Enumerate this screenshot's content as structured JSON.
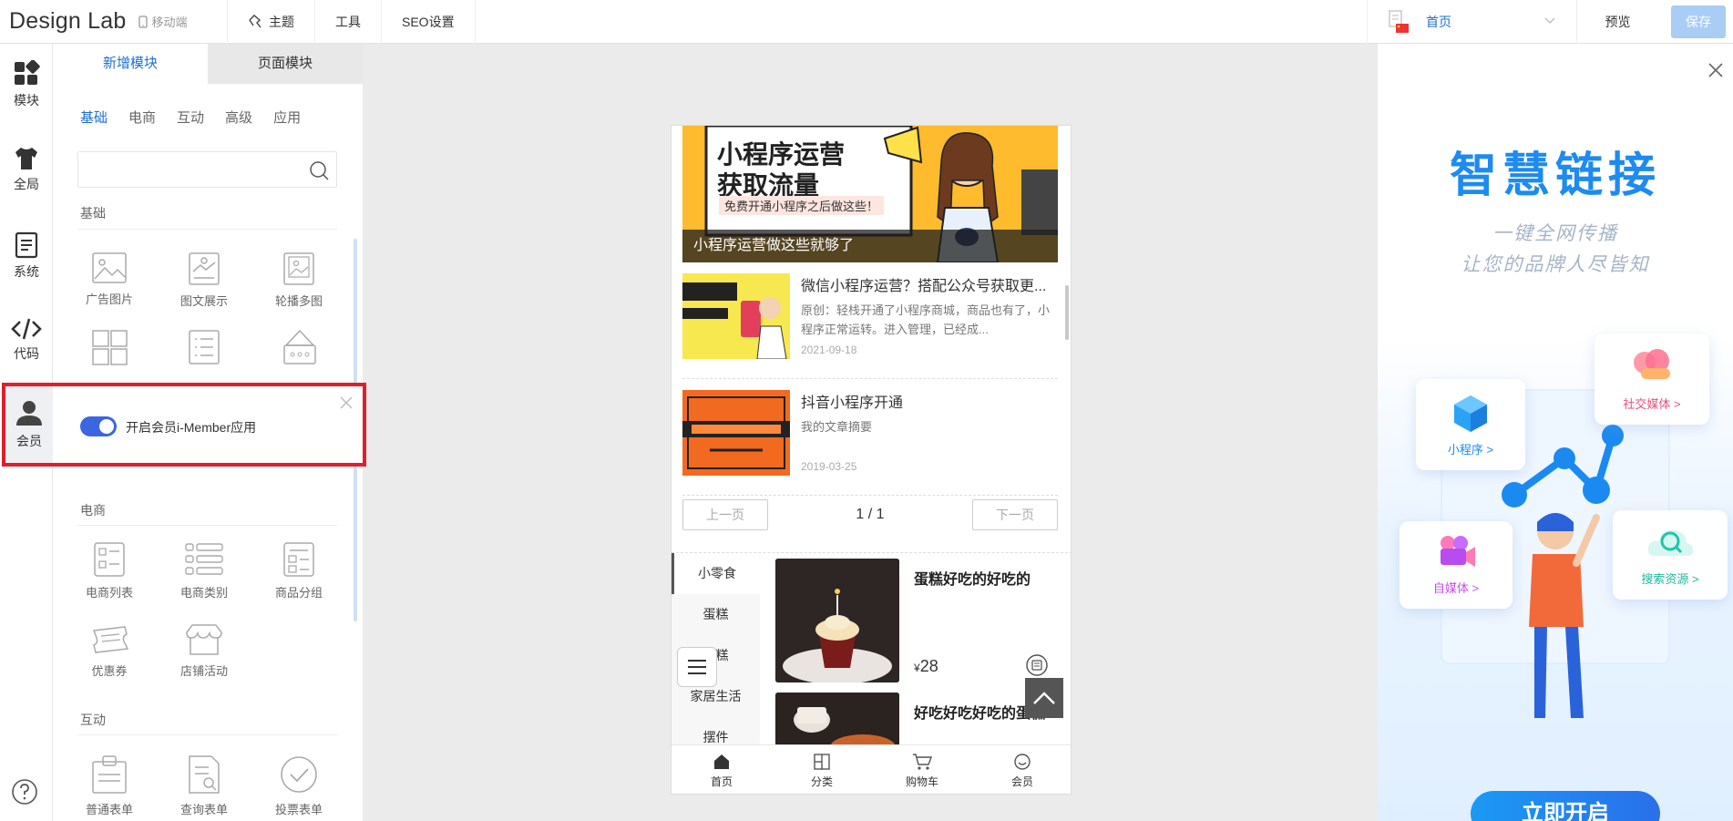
{
  "topbar": {
    "brand": "Design Lab",
    "mobile_label": "移动端",
    "nav": [
      {
        "label": "主题"
      },
      {
        "label": "工具"
      },
      {
        "label": "SEO设置"
      }
    ],
    "page_select": "首页",
    "preview": "预览",
    "save": "保存"
  },
  "rail": {
    "items": [
      {
        "label": "模块",
        "icon": "grid-icon"
      },
      {
        "label": "全局",
        "icon": "shirt-icon"
      },
      {
        "label": "系统",
        "icon": "document-icon"
      },
      {
        "label": "代码",
        "icon": "code-icon"
      },
      {
        "label": "会员",
        "icon": "user-icon"
      }
    ]
  },
  "panel": {
    "tabs": [
      "新增模块",
      "页面模块"
    ],
    "categories": [
      "基础",
      "电商",
      "互动",
      "高级",
      "应用"
    ],
    "search_placeholder": "",
    "sections": {
      "basic": "基础",
      "ecommerce": "电商",
      "interact": "互动"
    },
    "basic_tiles": [
      "广告图片",
      "图文展示",
      "轮播多图"
    ],
    "ecom_tiles": [
      "电商列表",
      "电商类别",
      "商品分组",
      "优惠券",
      "店铺活动"
    ],
    "interact_tiles": [
      "普通表单",
      "查询表单",
      "投票表单"
    ]
  },
  "member_popup": {
    "rail_label": "会员",
    "toggle_label": "开启会员i-Member应用",
    "enabled": true
  },
  "phone": {
    "banner": {
      "line1": "小程序运营",
      "line2": "获取流量",
      "sub": "免费开通小程序之后做这些！",
      "caption": "小程序运营做这些就够了"
    },
    "articles": [
      {
        "title": "微信小程序运营？搭配公众号获取更...",
        "desc": "原创：轻栈开通了小程序商城，商品也有了，小程序正常运转。进入管理，已经成...",
        "date": "2021-09-18"
      },
      {
        "title": "抖音小程序开通",
        "desc": "我的文章摘要",
        "date": "2019-03-25"
      }
    ],
    "pager": {
      "prev": "上一页",
      "page": "1 / 1",
      "next": "下一页"
    },
    "goods_categories": [
      "小零食",
      "蛋糕",
      "蛋糕",
      "家居生活",
      "摆件"
    ],
    "goods": [
      {
        "name": "蛋糕好吃的好吃的",
        "currency": "¥",
        "price": "28"
      },
      {
        "name": "好吃好吃好吃的蛋糕",
        "currency": "",
        "price": ""
      }
    ],
    "tabbar": [
      {
        "label": "首页",
        "icon": "home-icon"
      },
      {
        "label": "分类",
        "icon": "category-icon"
      },
      {
        "label": "购物车",
        "icon": "cart-icon"
      },
      {
        "label": "会员",
        "icon": "member-icon"
      }
    ]
  },
  "promo": {
    "title": "智慧链接",
    "sub1": "一键全网传播",
    "sub2": "让您的品牌人尽皆知",
    "cards": [
      "小程序 >",
      "社交媒体 >",
      "自媒体 >",
      "搜索资源 >"
    ],
    "cta": "立即开启"
  },
  "colors": {
    "accent": "#1f6fd1",
    "save_disabled": "#a9cdf5",
    "highlight_border": "#e11e2a",
    "toggle_on": "#3b66e0"
  }
}
